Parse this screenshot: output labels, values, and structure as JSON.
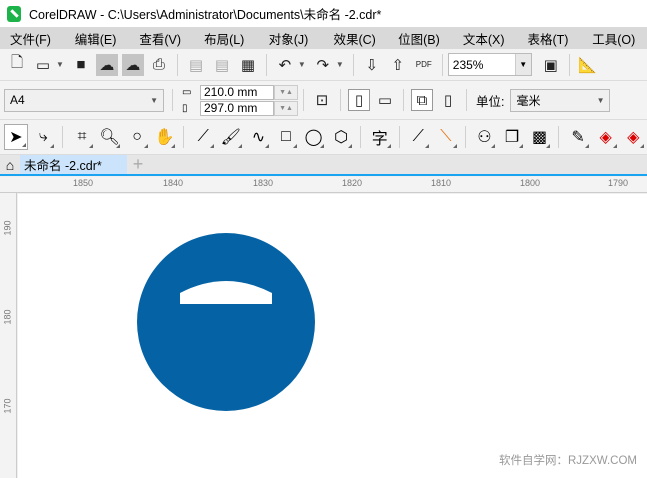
{
  "window": {
    "title": "CorelDRAW - C:\\Users\\Administrator\\Documents\\未命名 -2.cdr*"
  },
  "menu": [
    "文件(F)",
    "编辑(E)",
    "查看(V)",
    "布局(L)",
    "对象(J)",
    "效果(C)",
    "位图(B)",
    "文本(X)",
    "表格(T)",
    "工具(O)"
  ],
  "toolbar": {
    "zoom_value": "235%",
    "pdf_label": "PDF"
  },
  "property_bar": {
    "page_size": "A4",
    "width": "210.0 mm",
    "height": "297.0 mm",
    "unit_label": "单位:",
    "unit_value": "毫米"
  },
  "toolbox": {
    "text_tool_glyph": "字"
  },
  "document_tab": {
    "label": "未命名 -2.cdr*"
  },
  "ruler": {
    "h_ticks": [
      "1850",
      "1840",
      "1830",
      "1820",
      "1810",
      "1800",
      "1790"
    ],
    "v_ticks": [
      "190",
      "180",
      "170"
    ]
  },
  "drawing": {
    "fill_color": "#0563a5"
  },
  "watermark": "软件自学网：RJZXW.COM"
}
